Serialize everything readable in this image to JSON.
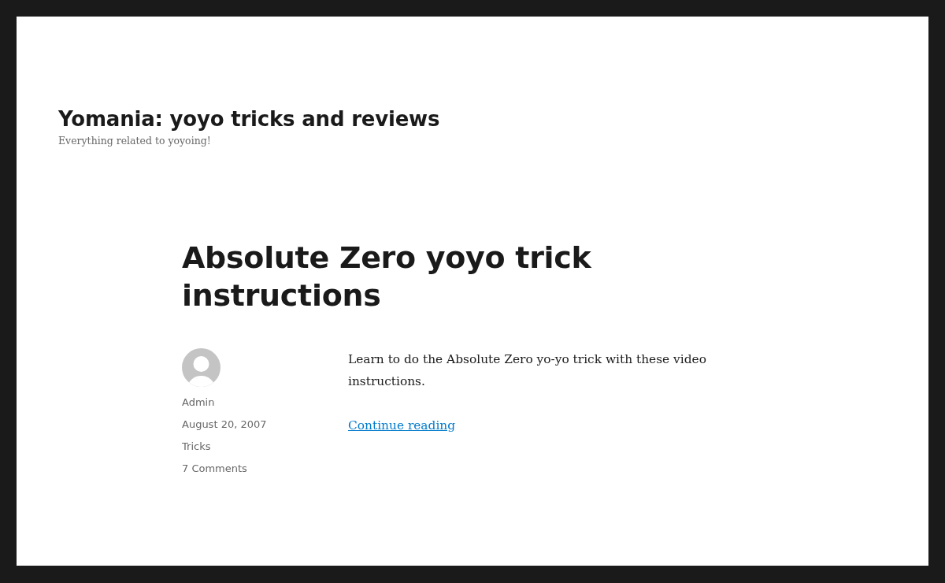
{
  "site": {
    "title": "Yomania: yoyo tricks and reviews",
    "tagline": "Everything related to yoyoing!"
  },
  "post": {
    "title": "Absolute Zero yoyo trick instructions",
    "meta": {
      "author": "Admin",
      "date": "August 20, 2007",
      "category": "Tricks",
      "comments": "7 Comments"
    },
    "excerpt": "Learn to do the Absolute Zero yo-yo trick with these video instructions.",
    "more_link": "Continue reading"
  }
}
